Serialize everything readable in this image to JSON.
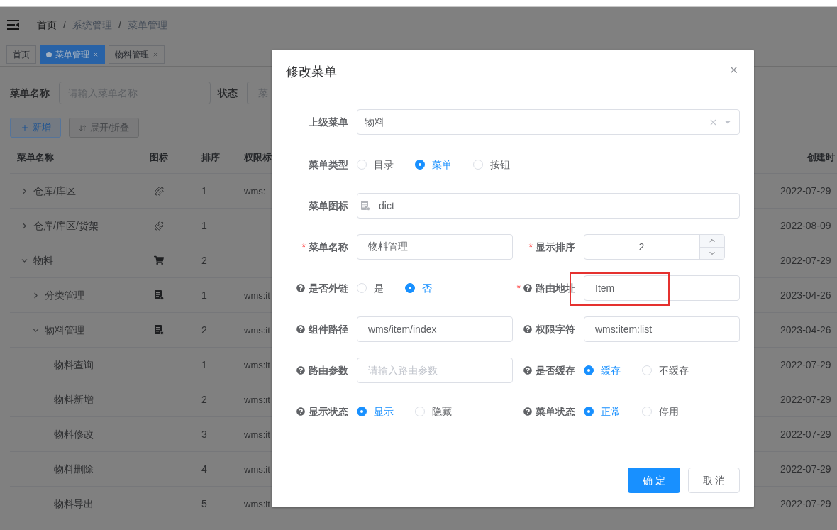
{
  "header": {
    "breadcrumb": [
      {
        "kind": "link",
        "text": "首页"
      },
      {
        "kind": "separator",
        "text": "/"
      },
      {
        "kind": "item",
        "text": "系统管理"
      },
      {
        "kind": "separator",
        "text": "/"
      },
      {
        "kind": "item",
        "text": "菜单管理"
      }
    ]
  },
  "tags": [
    {
      "label": "首页",
      "selected": false,
      "closable": false
    },
    {
      "label": "菜单管理",
      "selected": true,
      "closable": true
    },
    {
      "label": "物料管理",
      "selected": false,
      "closable": true
    }
  ],
  "search": {
    "fields": [
      {
        "label": "菜单名称",
        "placeholder": "请输入菜单名称"
      },
      {
        "label": "状态",
        "placeholder": "菜"
      }
    ]
  },
  "toolbar": {
    "buttons": [
      {
        "kind": "add",
        "label": "新增"
      },
      {
        "kind": "toggle",
        "label": "展开/折叠"
      }
    ]
  },
  "table": {
    "columns": [
      "菜单名称",
      "图标",
      "排序",
      "权限标",
      "创建时"
    ],
    "rows": [
      {
        "kind": "puzzle",
        "name": "仓库/库区",
        "sort": "1",
        "perms": "wms:",
        "created": "2022-07-29",
        "expanded": false
      },
      {
        "kind": "puzzle",
        "name": "仓库/库区/货架",
        "sort": "1",
        "created": "2022-08-09",
        "expanded": false
      },
      {
        "kind": "cart",
        "name": "物料",
        "sort": "2",
        "created": "2022-07-29",
        "expanded": true,
        "children": [
          {
            "kind": "document",
            "name": "分类管理",
            "sort": "1",
            "perms": "wms:it",
            "created": "2023-04-26",
            "expanded": false
          },
          {
            "kind": "document",
            "name": "物料管理",
            "sort": "2",
            "perms": "wms:it",
            "created": "2023-04-26",
            "expanded": true,
            "children": [
              {
                "name": "物料查询",
                "sort": "1",
                "perms": "wms:it",
                "created": "2022-07-29"
              },
              {
                "name": "物料新增",
                "sort": "2",
                "perms": "wms:it",
                "created": "2022-07-29"
              },
              {
                "name": "物料修改",
                "sort": "3",
                "perms": "wms:it",
                "created": "2022-07-29"
              },
              {
                "name": "物料删除",
                "sort": "4",
                "perms": "wms:it",
                "created": "2022-07-29"
              },
              {
                "name": "物料导出",
                "sort": "5",
                "perms": "wms:it",
                "created": "2022-07-29"
              }
            ]
          }
        ]
      }
    ]
  },
  "dialog": {
    "title": "修改菜单",
    "form_rows": [
      [
        {
          "kind": "select",
          "label": "上级菜单",
          "help": false,
          "value": "物料",
          "clearable": true
        }
      ],
      [
        {
          "kind": "radio",
          "label": "菜单类型",
          "help": false,
          "options": [
            {
              "label": "目录",
              "selected": false
            },
            {
              "label": "菜单",
              "selected": true
            },
            {
              "label": "按钮",
              "selected": false
            }
          ]
        }
      ],
      [
        {
          "kind": "icon-input",
          "label": "菜单图标",
          "help": false,
          "value": "dict"
        }
      ],
      [
        {
          "kind": "input",
          "label": "菜单名称",
          "required_mark": "*",
          "help": false,
          "value": "物料管理"
        },
        {
          "kind": "number",
          "label": "显示排序",
          "required_mark": "*",
          "help": false,
          "value": "2"
        }
      ],
      [
        {
          "kind": "radio",
          "label": "是否外链",
          "help": true,
          "options": [
            {
              "label": "是",
              "selected": false
            },
            {
              "label": "否",
              "selected": true
            }
          ]
        },
        {
          "kind": "input",
          "label": "路由地址",
          "required_mark": "*",
          "help": true,
          "value": "Item",
          "highlighted": true
        }
      ],
      [
        {
          "kind": "input",
          "label": "组件路径",
          "help": true,
          "value": "wms/item/index"
        },
        {
          "kind": "input",
          "label": "权限字符",
          "help": true,
          "value": "wms:item:list"
        }
      ],
      [
        {
          "kind": "input",
          "label": "路由参数",
          "help": true,
          "placeholder": "请输入路由参数"
        },
        {
          "kind": "radio",
          "label": "是否缓存",
          "help": true,
          "options": [
            {
              "label": "缓存",
              "selected": true
            },
            {
              "label": "不缓存",
              "selected": false
            }
          ]
        }
      ],
      [
        {
          "kind": "radio",
          "label": "显示状态",
          "help": true,
          "options": [
            {
              "label": "显示",
              "selected": true
            },
            {
              "label": "隐藏",
              "selected": false
            }
          ]
        },
        {
          "kind": "radio",
          "label": "菜单状态",
          "help": true,
          "options": [
            {
              "label": "正常",
              "selected": true
            },
            {
              "label": "停用",
              "selected": false
            }
          ]
        }
      ]
    ],
    "buttons": [
      {
        "kind": "primary",
        "label": "确 定"
      },
      {
        "kind": "default",
        "label": "取 消"
      }
    ]
  }
}
